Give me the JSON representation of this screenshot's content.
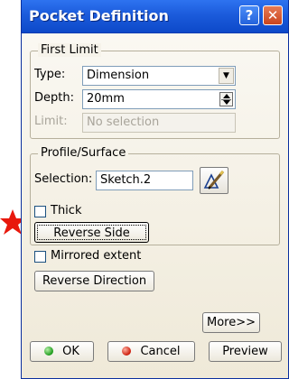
{
  "window": {
    "title": "Pocket Definition"
  },
  "first_limit": {
    "legend": "First Limit",
    "type_label": "Type:",
    "type_value": "Dimension",
    "depth_label": "Depth:",
    "depth_value": "20mm",
    "limit_label": "Limit:",
    "limit_value": "No selection"
  },
  "profile": {
    "legend": "Profile/Surface",
    "selection_label": "Selection:",
    "selection_value": "Sketch.2",
    "thick_label": "Thick",
    "thick_checked": false,
    "reverse_side_label": "Reverse Side"
  },
  "mirrored_label": "Mirrored extent",
  "mirrored_checked": false,
  "reverse_direction_label": "Reverse Direction",
  "more_label": "More>>",
  "footer": {
    "ok_label": "OK",
    "cancel_label": "Cancel",
    "preview_label": "Preview"
  },
  "colors": {
    "titlebar": "#1b5bdb",
    "dialog_bg": "#f3eee1",
    "annotation_star": "#e8180c"
  }
}
